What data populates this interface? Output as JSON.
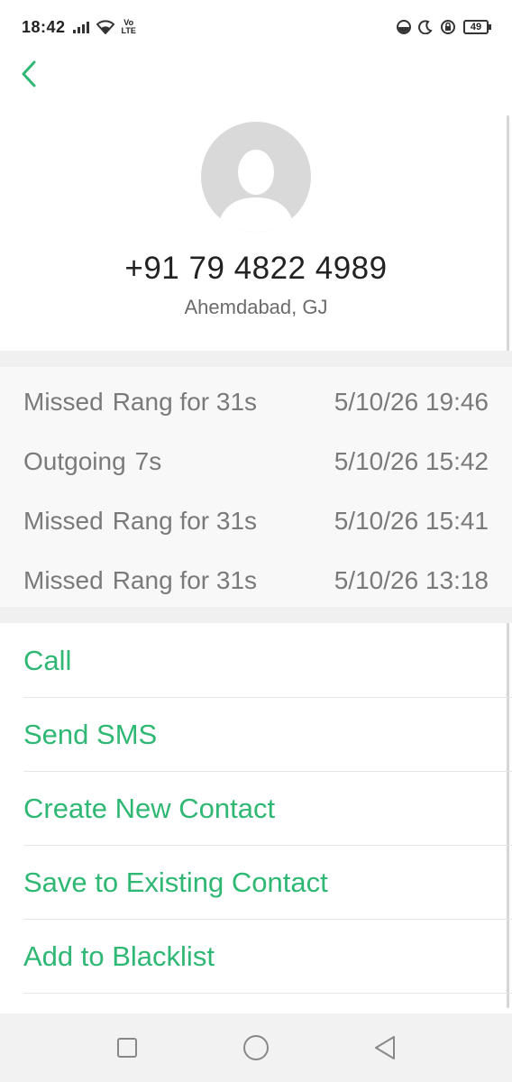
{
  "status_bar": {
    "time": "18:42",
    "network": "Vo\nLTE",
    "battery": "49",
    "icons": [
      "signal-icon",
      "wifi-icon",
      "data-saver-icon",
      "night-mode-icon",
      "rotation-lock-icon",
      "battery-icon"
    ]
  },
  "header": {
    "phone_number": "+91 79 4822 4989",
    "location": "Ahemdabad, GJ"
  },
  "history": [
    {
      "type": "Missed",
      "detail": "Rang for 31s",
      "datetime": "5/10/26 19:46"
    },
    {
      "type": "Outgoing",
      "detail": "7s",
      "datetime": "5/10/26 15:42"
    },
    {
      "type": "Missed",
      "detail": "Rang for 31s",
      "datetime": "5/10/26 15:41"
    },
    {
      "type": "Missed",
      "detail": "Rang for 31s",
      "datetime": "5/10/26 13:18"
    }
  ],
  "actions": {
    "call": "Call",
    "send_sms": "Send SMS",
    "create_contact": "Create New Contact",
    "save_existing": "Save to Existing Contact",
    "blacklist": "Add to Blacklist"
  },
  "colors": {
    "accent": "#2fb873",
    "history_bg": "#f8f8f8",
    "nav_bg": "#f2f2f2"
  }
}
